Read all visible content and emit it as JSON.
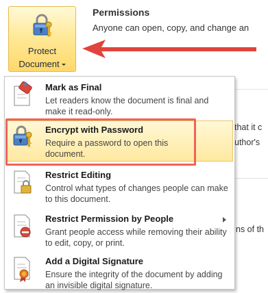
{
  "protect_button": {
    "label_line1": "Protect",
    "label_line2": "Document",
    "icon": "lock-key-icon"
  },
  "permissions": {
    "title": "Permissions",
    "description": "Anyone can open, copy, and change an"
  },
  "background_fragments": {
    "right1": "that it c",
    "right2": "uthor's",
    "right3": "ns of th"
  },
  "menu": {
    "items": [
      {
        "title": "Mark as Final",
        "description": "Let readers know the document is final and make it read-only.",
        "icon": "document-final-icon"
      },
      {
        "title": "Encrypt with Password",
        "description": "Require a password to open this document.",
        "icon": "lock-key-icon",
        "highlighted": true
      },
      {
        "title": "Restrict Editing",
        "description": "Control what types of changes people can make to this document.",
        "icon": "document-lock-icon"
      },
      {
        "title": "Restrict Permission by People",
        "description": "Grant people access while removing their ability to edit, copy, or print.",
        "icon": "document-restrict-icon",
        "has_submenu": true
      },
      {
        "title": "Add a Digital Signature",
        "description": "Ensure the integrity of the document by adding an invisible digital signature.",
        "icon": "document-ribbon-icon"
      }
    ]
  },
  "colors": {
    "highlight": "#ffe9a0",
    "annotation_red": "#e0443c",
    "button_gold": "#ffd86b"
  }
}
